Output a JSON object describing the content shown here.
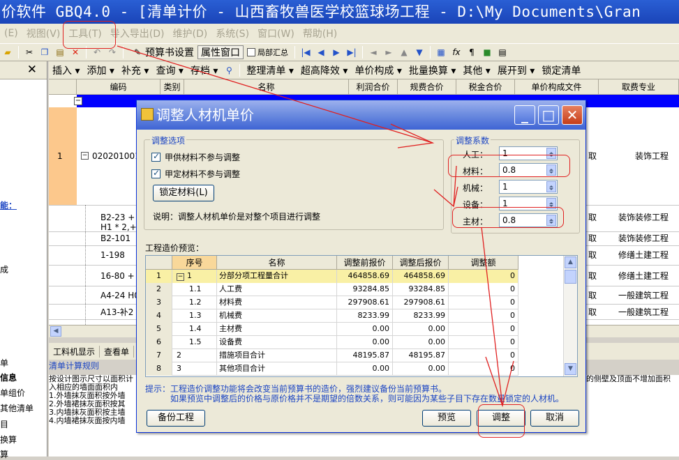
{
  "window": {
    "title": "价软件 GBQ4.0 - [清单计价 - 山西畜牧兽医学校篮球场工程 - D:\\My Documents\\Gran"
  },
  "menu": [
    {
      "label": "(E)"
    },
    {
      "label": "视图(V)"
    },
    {
      "label": "工具(T)"
    },
    {
      "label": "导入导出(D)"
    },
    {
      "label": "维护(D)"
    },
    {
      "label": "系统(S)"
    },
    {
      "label": "窗口(W)"
    },
    {
      "label": "帮助(H)"
    }
  ],
  "toolbar1": {
    "budget_settings": "预算书设置",
    "property_window": "属性窗口",
    "partial_summary": "局部汇总"
  },
  "toolbar2": [
    {
      "label": "插入 ▾"
    },
    {
      "label": "添加 ▾"
    },
    {
      "label": "补充 ▾"
    },
    {
      "label": "查询 ▾"
    },
    {
      "label": "存档 ▾"
    },
    {
      "label": "整理清单 ▾"
    },
    {
      "label": "超高降效 ▾"
    },
    {
      "label": "单价构成 ▾"
    },
    {
      "label": "批量换算 ▾"
    },
    {
      "label": "其他 ▾"
    },
    {
      "label": "展开到 ▾"
    },
    {
      "label": "锁定清单"
    }
  ],
  "grid": {
    "headers": [
      "编码",
      "类别",
      "名称",
      "利润合价",
      "规费合价",
      "税金合价",
      "单价构成文件",
      "取费专业"
    ],
    "row1_num": "1",
    "row1_code": "020201001",
    "row1_mode": "取",
    "row1_prof": "装饰工程",
    "subrows": [
      {
        "code": "B2-23 + B",
        "mode": "取",
        "prof": "装饰装修工程"
      },
      {
        "code": "H1 * 2,+",
        "mode": "",
        "prof": ""
      },
      {
        "code": "B2-101",
        "mode": "取",
        "prof": "装饰装修工程"
      },
      {
        "code": "1-198",
        "mode": "取",
        "prof": "修缮土建工程"
      },
      {
        "code": "16-80 + 1",
        "mode": "取",
        "prof": "修缮土建工程"
      },
      {
        "code": "A4-24 H02",
        "mode": "取",
        "prof": "一般建筑工程"
      },
      {
        "code": "A13-补2",
        "mode": "取",
        "prof": "一般建筑工程"
      }
    ]
  },
  "left_panel": {
    "label_a": "能：",
    "label_b": "成",
    "items": [
      "单",
      "信息",
      "单组价",
      "其他清单",
      "目",
      "换算",
      "算"
    ]
  },
  "bottom": {
    "tabs": [
      "工料机显示",
      "查看单"
    ],
    "title": "清单计算规则",
    "lines": [
      "按设计图示尺寸以面积计",
      "入相应的墙面面积内",
      "1.外墙抹灰面积按外墙",
      "2.外墙裙抹灰面积按其",
      "3.内墙抹灰面积按主墙",
      "4.内墙裙抹灰面按内墙"
    ],
    "right_fragment": "的侧壁及顶面不增加面积"
  },
  "dialog": {
    "title": "调整人材机单价",
    "options_group": "调整选项",
    "cb1": {
      "label": "甲供材料不参与调整",
      "checked": true
    },
    "cb2": {
      "label": "甲定材料不参与调整",
      "checked": true
    },
    "lock_button": "锁定材料(L)",
    "description": "说明：调整人材机单价是对整个项目进行调整",
    "coef_group": "调整系数",
    "coefficients": [
      {
        "label": "人工：",
        "value": "1"
      },
      {
        "label": "材料：",
        "value": "0.8"
      },
      {
        "label": "机械：",
        "value": "1"
      },
      {
        "label": "设备：",
        "value": "1"
      },
      {
        "label": "主材：",
        "value": "0.8"
      }
    ],
    "preview_label": "工程造价预览：",
    "preview_headers": [
      "序号",
      "名称",
      "调整前报价",
      "调整后报价",
      "调整额"
    ],
    "preview_rows": [
      {
        "idx": "1",
        "seq": "1",
        "name": "分部分项工程量合计",
        "before": "464858.69",
        "after": "464858.69",
        "diff": "0",
        "expand": true
      },
      {
        "idx": "2",
        "seq": "1.1",
        "name": "人工费",
        "before": "93284.85",
        "after": "93284.85",
        "diff": "0"
      },
      {
        "idx": "3",
        "seq": "1.2",
        "name": "材料费",
        "before": "297908.61",
        "after": "297908.61",
        "diff": "0"
      },
      {
        "idx": "4",
        "seq": "1.3",
        "name": "机械费",
        "before": "8233.99",
        "after": "8233.99",
        "diff": "0"
      },
      {
        "idx": "5",
        "seq": "1.4",
        "name": "主材费",
        "before": "0.00",
        "after": "0.00",
        "diff": "0"
      },
      {
        "idx": "6",
        "seq": "1.5",
        "name": "设备费",
        "before": "0.00",
        "after": "0.00",
        "diff": "0"
      },
      {
        "idx": "7",
        "seq": "2",
        "name": "措施项目合计",
        "before": "48195.87",
        "after": "48195.87",
        "diff": "0"
      },
      {
        "idx": "8",
        "seq": "3",
        "name": "其他项目合计",
        "before": "0.00",
        "after": "0.00",
        "diff": "0"
      }
    ],
    "hint1": "提示：工程造价调整功能将会改变当前预算书的造价，强烈建议备份当前预算书。",
    "hint2": "如果预览中调整后的价格与原价格并不是期望的倍数关系，则可能因为某些子目下存在数量锁定的人材机。",
    "backup_button": "备份工程",
    "preview_button": "预览",
    "adjust_button": "调整",
    "cancel_button": "取消"
  },
  "annotation_color": "#e02020"
}
